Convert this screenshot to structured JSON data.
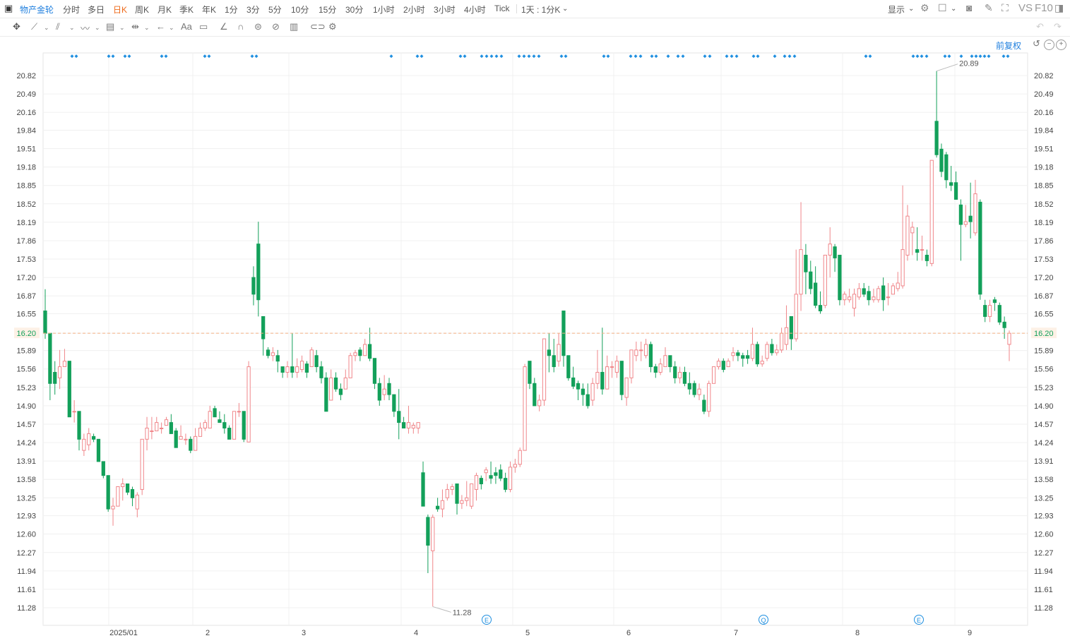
{
  "topbar": {
    "title": "物产金轮",
    "periods": [
      "分时",
      "多日",
      "日K",
      "周K",
      "月K",
      "季K",
      "年K",
      "1分",
      "3分",
      "5分",
      "10分",
      "15分",
      "30分",
      "1小时",
      "2小时",
      "3小时",
      "4小时",
      "Tick",
      "1天 : 1分K"
    ],
    "active_period": "日K",
    "right": {
      "display_label": "显示",
      "vs_label": "VS",
      "f10_label": "F10"
    }
  },
  "toolbar": {
    "text_tool": "Aa"
  },
  "adjust": {
    "label": "前复权"
  },
  "colors": {
    "up": "#f0868a",
    "down": "#13a05a",
    "reference": "#f4b183",
    "dots": "#1f8fe0",
    "grid": "#f0f0f0"
  },
  "chart_data": {
    "type": "candlestick",
    "reference_price": "16.20",
    "y_ticks": [
      "20.82",
      "20.49",
      "20.16",
      "19.84",
      "19.51",
      "19.18",
      "18.85",
      "18.52",
      "18.19",
      "17.86",
      "17.53",
      "17.20",
      "16.87",
      "16.55",
      "16.20",
      "15.89",
      "15.56",
      "15.23",
      "14.90",
      "14.57",
      "14.24",
      "13.91",
      "13.58",
      "13.25",
      "12.93",
      "12.60",
      "12.27",
      "11.94",
      "11.61",
      "11.28"
    ],
    "x_labels": [
      "2025/01",
      "2",
      "3",
      "4",
      "5",
      "6",
      "7",
      "8",
      "9"
    ],
    "max_label": "20.89",
    "min_label": "11.28",
    "event_markers": [
      "E",
      "Q",
      "E"
    ],
    "candles": [
      [
        16.6,
        16.2,
        16.99,
        16.1
      ],
      [
        16.2,
        15.3,
        16.2,
        15.0
      ],
      [
        15.5,
        15.3,
        15.7,
        15.1
      ],
      [
        15.4,
        15.6,
        15.9,
        15.2
      ],
      [
        15.6,
        15.7,
        15.92,
        15.6
      ],
      [
        15.7,
        14.7,
        15.7,
        14.7
      ],
      [
        14.8,
        14.8,
        15.0,
        14.6
      ],
      [
        14.8,
        14.3,
        14.8,
        14.1
      ],
      [
        14.1,
        14.3,
        14.4,
        14.0
      ],
      [
        14.2,
        14.4,
        14.5,
        14.1
      ],
      [
        14.35,
        14.3,
        14.4,
        14.25
      ],
      [
        14.3,
        13.9,
        14.3,
        13.9
      ],
      [
        13.9,
        13.65,
        13.9,
        13.6
      ],
      [
        13.65,
        13.05,
        13.65,
        13.0
      ],
      [
        13.05,
        13.1,
        13.25,
        12.75
      ],
      [
        13.1,
        13.45,
        13.45,
        13.1
      ],
      [
        13.45,
        13.5,
        13.6,
        13.2
      ],
      [
        13.5,
        13.35,
        13.5,
        13.3
      ],
      [
        13.4,
        13.25,
        13.45,
        13.1
      ],
      [
        13.05,
        13.3,
        13.35,
        12.9
      ],
      [
        13.4,
        14.3,
        14.3,
        13.3
      ],
      [
        14.3,
        14.5,
        14.7,
        14.1
      ],
      [
        14.45,
        14.45,
        14.7,
        14.3
      ],
      [
        14.45,
        14.6,
        14.7,
        14.45
      ],
      [
        14.5,
        14.5,
        14.6,
        14.4
      ],
      [
        14.55,
        14.65,
        14.7,
        14.55
      ],
      [
        14.6,
        14.4,
        14.75,
        14.4
      ],
      [
        14.45,
        14.15,
        14.5,
        14.15
      ],
      [
        14.3,
        14.35,
        14.55,
        14.3
      ],
      [
        14.3,
        14.3,
        14.4,
        14.2
      ],
      [
        14.3,
        14.1,
        14.35,
        14.05
      ],
      [
        14.1,
        14.35,
        14.5,
        14.1
      ],
      [
        14.35,
        14.5,
        14.6,
        14.35
      ],
      [
        14.5,
        14.6,
        14.65,
        14.45
      ],
      [
        14.5,
        14.8,
        14.9,
        14.5
      ],
      [
        14.85,
        14.7,
        14.9,
        14.7
      ],
      [
        14.65,
        14.6,
        14.8,
        14.6
      ],
      [
        14.6,
        14.5,
        14.75,
        14.4
      ],
      [
        14.5,
        14.3,
        14.55,
        14.3
      ],
      [
        14.3,
        14.8,
        14.8,
        14.3
      ],
      [
        14.8,
        14.8,
        14.95,
        14.7
      ],
      [
        14.8,
        14.3,
        14.8,
        14.25
      ],
      [
        14.25,
        15.6,
        15.7,
        14.25
      ],
      [
        17.2,
        16.9,
        17.4,
        16.7
      ],
      [
        17.8,
        16.8,
        18.2,
        16.5
      ],
      [
        16.5,
        16.1,
        16.5,
        15.8
      ],
      [
        15.9,
        15.8,
        15.95,
        15.75
      ],
      [
        15.8,
        15.85,
        15.95,
        15.7
      ],
      [
        15.8,
        15.7,
        15.9,
        15.5
      ],
      [
        15.6,
        15.5,
        15.6,
        15.4
      ],
      [
        15.5,
        15.6,
        15.7,
        15.4
      ],
      [
        15.6,
        15.5,
        16.2,
        15.4
      ],
      [
        15.5,
        15.6,
        15.75,
        15.4
      ],
      [
        15.55,
        15.7,
        15.8,
        15.5
      ],
      [
        15.65,
        15.5,
        15.7,
        15.4
      ],
      [
        15.6,
        15.9,
        15.95,
        15.6
      ],
      [
        15.8,
        15.6,
        15.9,
        15.5
      ],
      [
        15.6,
        15.4,
        15.7,
        15.3
      ],
      [
        15.4,
        14.8,
        15.5,
        14.8
      ],
      [
        15.0,
        15.4,
        15.55,
        15.0
      ],
      [
        15.4,
        15.2,
        15.5,
        15.15
      ],
      [
        15.2,
        15.1,
        15.3,
        15.0
      ],
      [
        15.2,
        15.4,
        15.55,
        15.2
      ],
      [
        15.4,
        15.8,
        15.85,
        15.4
      ],
      [
        15.8,
        15.85,
        15.9,
        15.7
      ],
      [
        15.9,
        15.8,
        15.95,
        15.7
      ],
      [
        15.8,
        16.0,
        16.1,
        15.8
      ],
      [
        16.0,
        15.75,
        16.3,
        15.7
      ],
      [
        15.75,
        15.3,
        15.75,
        15.2
      ],
      [
        15.3,
        15.0,
        15.4,
        14.9
      ],
      [
        15.1,
        15.2,
        15.45,
        15.0
      ],
      [
        15.3,
        15.1,
        15.4,
        15.0
      ],
      [
        15.1,
        14.8,
        15.1,
        14.7
      ],
      [
        14.8,
        14.6,
        15.2,
        14.3
      ],
      [
        14.6,
        14.5,
        14.7,
        14.5
      ],
      [
        14.5,
        14.6,
        14.9,
        14.4
      ],
      [
        14.5,
        14.55,
        14.6,
        14.4
      ],
      [
        14.5,
        14.6,
        14.6,
        14.4
      ],
      [
        13.7,
        13.1,
        13.9,
        13.1
      ],
      [
        12.9,
        12.4,
        12.95,
        11.9
      ],
      [
        12.3,
        12.9,
        12.95,
        11.3
      ],
      [
        13.1,
        13.05,
        13.25,
        13.0
      ],
      [
        13.05,
        13.2,
        13.4,
        12.9
      ],
      [
        13.25,
        13.4,
        13.5,
        13.2
      ],
      [
        13.4,
        13.45,
        13.5,
        13.3
      ],
      [
        13.5,
        13.15,
        13.5,
        12.95
      ],
      [
        13.15,
        13.2,
        13.3,
        13.05
      ],
      [
        13.2,
        13.25,
        13.55,
        13.1
      ],
      [
        13.1,
        13.5,
        13.5,
        13.05
      ],
      [
        13.4,
        13.65,
        13.7,
        13.2
      ],
      [
        13.6,
        13.5,
        13.65,
        13.4
      ],
      [
        13.7,
        13.75,
        13.8,
        13.55
      ],
      [
        13.65,
        13.6,
        13.9,
        13.5
      ],
      [
        13.7,
        13.65,
        13.8,
        13.5
      ],
      [
        13.75,
        13.6,
        13.85,
        13.55
      ],
      [
        13.6,
        13.4,
        13.7,
        13.35
      ],
      [
        13.4,
        13.8,
        13.9,
        13.35
      ],
      [
        13.8,
        13.85,
        13.95,
        13.7
      ],
      [
        13.85,
        14.1,
        14.15,
        13.8
      ],
      [
        14.1,
        15.6,
        15.65,
        14.1
      ],
      [
        15.7,
        15.3,
        15.7,
        15.2
      ],
      [
        15.3,
        14.9,
        15.4,
        14.9
      ],
      [
        14.9,
        15.0,
        15.1,
        14.8
      ],
      [
        15.0,
        16.1,
        16.1,
        14.9
      ],
      [
        15.9,
        15.8,
        16.2,
        15.5
      ],
      [
        15.8,
        15.6,
        16.1,
        15.5
      ],
      [
        15.7,
        16.0,
        16.2,
        15.6
      ],
      [
        16.6,
        15.8,
        16.6,
        15.6
      ],
      [
        15.8,
        15.4,
        15.8,
        15.35
      ],
      [
        15.4,
        15.25,
        15.6,
        15.2
      ],
      [
        15.3,
        15.2,
        15.35,
        15.0
      ],
      [
        15.2,
        15.1,
        15.3,
        14.9
      ],
      [
        15.1,
        14.9,
        15.3,
        14.85
      ],
      [
        15.0,
        15.3,
        15.4,
        14.9
      ],
      [
        15.3,
        15.5,
        15.9,
        15.2
      ],
      [
        15.5,
        15.2,
        16.3,
        15.1
      ],
      [
        15.2,
        15.6,
        15.8,
        15.2
      ],
      [
        15.6,
        15.6,
        15.7,
        15.4
      ],
      [
        15.5,
        15.7,
        15.8,
        15.4
      ],
      [
        15.7,
        15.1,
        15.7,
        15.0
      ],
      [
        15.05,
        15.4,
        15.4,
        14.9
      ],
      [
        15.4,
        15.9,
        15.9,
        15.3
      ],
      [
        15.8,
        15.9,
        16.05,
        15.7
      ],
      [
        15.9,
        15.9,
        16.05,
        15.7
      ],
      [
        15.8,
        16.0,
        16.1,
        15.75
      ],
      [
        16.0,
        15.6,
        16.05,
        15.5
      ],
      [
        15.6,
        15.5,
        15.65,
        15.4
      ],
      [
        15.5,
        15.65,
        15.75,
        15.45
      ],
      [
        15.6,
        15.8,
        15.95,
        15.6
      ],
      [
        15.8,
        15.6,
        15.8,
        15.5
      ],
      [
        15.6,
        15.4,
        15.7,
        15.3
      ],
      [
        15.4,
        15.5,
        15.6,
        15.3
      ],
      [
        15.5,
        15.3,
        15.6,
        15.25
      ],
      [
        15.3,
        15.2,
        15.5,
        15.1
      ],
      [
        15.3,
        15.1,
        15.35,
        15.05
      ],
      [
        15.1,
        15.2,
        15.3,
        15.0
      ],
      [
        15.0,
        14.8,
        15.1,
        14.75
      ],
      [
        14.8,
        15.3,
        15.35,
        14.7
      ],
      [
        15.3,
        15.6,
        15.6,
        15.3
      ],
      [
        15.6,
        15.7,
        15.75,
        15.55
      ],
      [
        15.7,
        15.55,
        15.75,
        15.5
      ],
      [
        15.6,
        15.7,
        15.75,
        15.6
      ],
      [
        15.8,
        15.85,
        15.95,
        15.7
      ],
      [
        15.85,
        15.8,
        15.9,
        15.7
      ],
      [
        15.8,
        15.75,
        15.85,
        15.6
      ],
      [
        15.8,
        15.75,
        15.9,
        15.65
      ],
      [
        15.75,
        16.0,
        16.3,
        15.7
      ],
      [
        16.0,
        15.65,
        16.05,
        15.6
      ],
      [
        15.65,
        15.7,
        15.8,
        15.6
      ],
      [
        15.75,
        16.0,
        16.05,
        15.7
      ],
      [
        16.0,
        15.85,
        16.1,
        15.8
      ],
      [
        15.85,
        15.9,
        16.0,
        15.8
      ],
      [
        15.9,
        16.2,
        16.3,
        15.85
      ],
      [
        16.0,
        16.3,
        16.7,
        15.9
      ],
      [
        16.5,
        16.1,
        16.5,
        15.9
      ],
      [
        16.1,
        16.9,
        17.7,
        16.05
      ],
      [
        16.9,
        17.7,
        18.55,
        16.6
      ],
      [
        17.6,
        17.3,
        17.8,
        16.9
      ],
      [
        17.3,
        17.0,
        17.5,
        16.9
      ],
      [
        17.1,
        16.7,
        17.4,
        16.65
      ],
      [
        16.7,
        16.6,
        16.95,
        16.55
      ],
      [
        16.7,
        17.6,
        17.6,
        16.65
      ],
      [
        17.6,
        17.8,
        18.1,
        17.2
      ],
      [
        17.75,
        17.55,
        17.8,
        17.3
      ],
      [
        17.6,
        16.8,
        17.6,
        16.7
      ],
      [
        16.8,
        16.9,
        16.95,
        16.7
      ],
      [
        16.8,
        16.85,
        17.0,
        16.75
      ],
      [
        16.65,
        16.9,
        17.0,
        16.5
      ],
      [
        16.85,
        17.0,
        17.1,
        16.8
      ],
      [
        17.0,
        16.9,
        17.1,
        16.85
      ],
      [
        16.95,
        16.8,
        17.05,
        16.7
      ],
      [
        16.8,
        16.85,
        17.0,
        16.75
      ],
      [
        16.8,
        17.0,
        17.05,
        16.75
      ],
      [
        17.05,
        16.8,
        17.2,
        16.6
      ],
      [
        16.85,
        16.85,
        17.1,
        16.7
      ],
      [
        16.9,
        17.05,
        17.1,
        16.9
      ],
      [
        17.0,
        17.1,
        17.3,
        16.95
      ],
      [
        17.05,
        17.7,
        18.85,
        17.0
      ],
      [
        17.6,
        18.3,
        18.5,
        17.5
      ],
      [
        18.0,
        18.1,
        18.2,
        17.6
      ],
      [
        17.7,
        17.65,
        18.1,
        17.5
      ],
      [
        17.7,
        17.7,
        17.95,
        17.5
      ],
      [
        17.6,
        17.5,
        17.7,
        17.4
      ],
      [
        17.45,
        19.3,
        19.3,
        17.4
      ],
      [
        20.0,
        19.4,
        20.9,
        19.35
      ],
      [
        19.5,
        19.1,
        19.6,
        19.0
      ],
      [
        19.4,
        18.95,
        19.45,
        18.8
      ],
      [
        18.9,
        18.85,
        19.2,
        18.75
      ],
      [
        18.9,
        18.6,
        19.1,
        18.6
      ],
      [
        18.5,
        18.15,
        18.6,
        17.5
      ],
      [
        18.15,
        18.2,
        18.5,
        18.1
      ],
      [
        18.3,
        18.2,
        18.9,
        17.9
      ],
      [
        18.0,
        18.7,
        18.95,
        17.95
      ],
      [
        18.55,
        16.9,
        18.6,
        16.8
      ],
      [
        16.7,
        16.5,
        16.8,
        16.4
      ],
      [
        16.5,
        16.7,
        16.8,
        16.4
      ],
      [
        16.8,
        16.75,
        16.85,
        16.6
      ],
      [
        16.7,
        16.4,
        16.75,
        16.35
      ],
      [
        16.4,
        16.3,
        16.5,
        16.1
      ],
      [
        16.0,
        16.2,
        16.25,
        15.7
      ]
    ]
  }
}
